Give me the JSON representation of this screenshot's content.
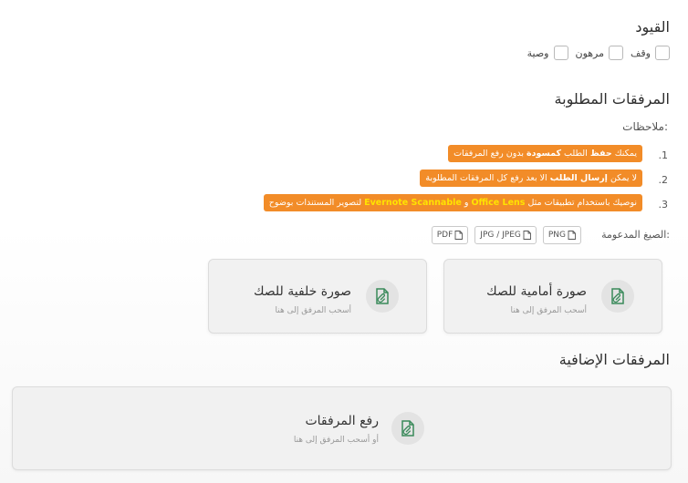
{
  "restrictions": {
    "title": "القيود",
    "options": [
      {
        "label": "وقف",
        "checked": false
      },
      {
        "label": "مرهون",
        "checked": false
      },
      {
        "label": "وصية",
        "checked": false
      }
    ]
  },
  "required_attachments": {
    "title": "المرفقات المطلوبة",
    "notes_label": "ملاحظات:",
    "notes": [
      {
        "num": ".1",
        "before": "يمكنك ",
        "bold1": "حفظ",
        "mid1": " الطلب ",
        "bold2": "كمسودة",
        "after": " بدون رفع المرفقات"
      },
      {
        "num": ".2",
        "before": "لا يمكن ",
        "bold1": "إرسال الطلب",
        "after": " الا بعد رفع كل المرفقات المطلوبة"
      },
      {
        "num": ".3",
        "before": "نوصيك باستخدام تطبيقات مثل ",
        "hl1": "Office Lens",
        "mid1": " و ",
        "hl2": "Evernote Scannable",
        "after": " لتصوير المستندات بوضوح"
      }
    ],
    "formats_label": "الصيغ المدعومة:",
    "formats": [
      "PNG",
      "JPG / JPEG",
      "PDF"
    ],
    "cards": [
      {
        "title": "صورة أمامية للصك",
        "subtitle": "أسحب المرفق إلى هنا"
      },
      {
        "title": "صورة خلفية للصك",
        "subtitle": "أسحب المرفق إلى هنا"
      }
    ]
  },
  "additional_attachments": {
    "title": "المرفقات الإضافية",
    "upload": {
      "title": "رفع المرفقات",
      "subtitle": "أو أسحب المرفق إلى هنا"
    }
  },
  "colors": {
    "accent": "#f28c28",
    "highlight": "#ffe300",
    "icon_green": "#3a8a5b"
  }
}
